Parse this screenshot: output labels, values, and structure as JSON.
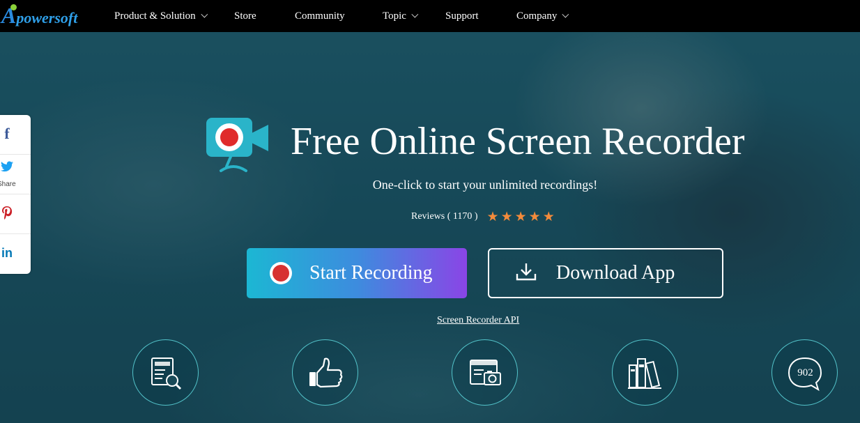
{
  "header": {
    "logo_text": "powersoft",
    "logo_initial": "A",
    "nav": [
      {
        "label": "Product & Solution",
        "has_dropdown": true
      },
      {
        "label": "Store",
        "has_dropdown": false
      },
      {
        "label": "Community",
        "has_dropdown": false
      },
      {
        "label": "Topic",
        "has_dropdown": true
      },
      {
        "label": "Support",
        "has_dropdown": false
      },
      {
        "label": "Company",
        "has_dropdown": true
      }
    ]
  },
  "share_bar": {
    "items": [
      {
        "icon": "facebook-icon",
        "glyph": "f",
        "color": "#3b5998"
      },
      {
        "icon": "twitter-icon",
        "glyph": "🐦",
        "color": "#1da1f2",
        "label": "Share"
      },
      {
        "icon": "pinterest-icon",
        "glyph": "P",
        "color": "#cb2027"
      },
      {
        "icon": "linkedin-icon",
        "glyph": "in",
        "color": "#0077b5"
      }
    ]
  },
  "hero": {
    "title": "Free Online Screen Recorder",
    "subtitle": "One-click to start your unlimited recordings!",
    "reviews_label": "Reviews ( 1170 )",
    "rating_stars": 5,
    "star_color": "#f48b3b"
  },
  "actions": {
    "start_label": "Start Recording",
    "download_label": "Download App",
    "api_link": "Screen Recorder API"
  },
  "features": [
    {
      "icon": "document-search-icon"
    },
    {
      "icon": "thumbs-up-icon"
    },
    {
      "icon": "screen-camera-icon"
    },
    {
      "icon": "books-icon"
    },
    {
      "icon": "comment-bubble-icon",
      "count": "902"
    }
  ],
  "colors": {
    "accent_cyan": "#1cb7d3",
    "accent_purple": "#8a45e6",
    "record_red": "#d73131",
    "feature_ring": "#5fdce1"
  }
}
